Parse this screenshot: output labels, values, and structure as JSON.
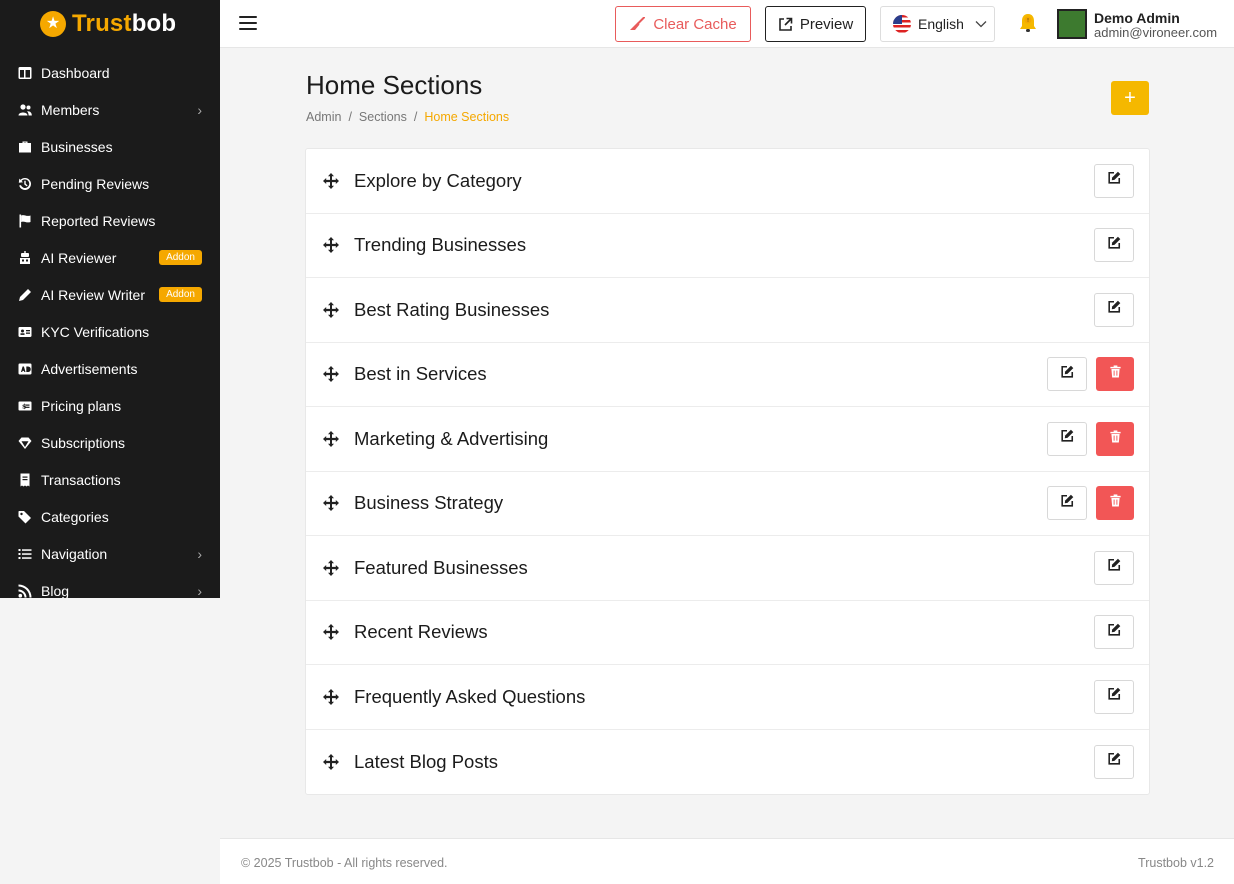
{
  "brand": {
    "name_part1": "Trust",
    "name_part2": "bob",
    "accent": "#f5a800"
  },
  "sidebar": {
    "items": [
      {
        "label": "Dashboard",
        "icon": "dashboard-icon",
        "chevron": false,
        "badge": ""
      },
      {
        "label": "Members",
        "icon": "users-icon",
        "chevron": true,
        "badge": ""
      },
      {
        "label": "Businesses",
        "icon": "briefcase-icon",
        "chevron": false,
        "badge": ""
      },
      {
        "label": "Pending Reviews",
        "icon": "history-icon",
        "chevron": false,
        "badge": ""
      },
      {
        "label": "Reported Reviews",
        "icon": "flag-icon",
        "chevron": false,
        "badge": ""
      },
      {
        "label": "AI Reviewer",
        "icon": "robot-icon",
        "chevron": false,
        "badge": "Addon"
      },
      {
        "label": "AI Review Writer",
        "icon": "pen-icon",
        "chevron": false,
        "badge": "Addon"
      },
      {
        "label": "KYC Verifications",
        "icon": "id-card-icon",
        "chevron": false,
        "badge": ""
      },
      {
        "label": "Advertisements",
        "icon": "ad-icon",
        "chevron": false,
        "badge": ""
      },
      {
        "label": "Pricing plans",
        "icon": "money-icon",
        "chevron": false,
        "badge": ""
      },
      {
        "label": "Subscriptions",
        "icon": "gem-icon",
        "chevron": false,
        "badge": ""
      },
      {
        "label": "Transactions",
        "icon": "receipt-icon",
        "chevron": false,
        "badge": ""
      },
      {
        "label": "Categories",
        "icon": "tags-icon",
        "chevron": false,
        "badge": ""
      },
      {
        "label": "Navigation",
        "icon": "list-icon",
        "chevron": true,
        "badge": ""
      },
      {
        "label": "Blog",
        "icon": "rss-icon",
        "chevron": true,
        "badge": ""
      }
    ]
  },
  "topbar": {
    "clear_cache_label": "Clear Cache",
    "preview_label": "Preview",
    "language": "English",
    "user_name": "Demo Admin",
    "user_email": "admin@vironeer.com"
  },
  "page": {
    "title": "Home Sections",
    "breadcrumb": [
      "Admin",
      "Sections",
      "Home Sections"
    ],
    "add_label": "+"
  },
  "sections": [
    {
      "title": "Explore by Category",
      "deletable": false
    },
    {
      "title": "Trending Businesses",
      "deletable": false
    },
    {
      "title": "Best Rating Businesses",
      "deletable": false
    },
    {
      "title": "Best in Services",
      "deletable": true
    },
    {
      "title": "Marketing & Advertising",
      "deletable": true
    },
    {
      "title": "Business Strategy",
      "deletable": true
    },
    {
      "title": "Featured Businesses",
      "deletable": false
    },
    {
      "title": "Recent Reviews",
      "deletable": false
    },
    {
      "title": "Frequently Asked Questions",
      "deletable": false
    },
    {
      "title": "Latest Blog Posts",
      "deletable": false
    }
  ],
  "footer": {
    "copyright": "© 2025 Trustbob - All rights reserved.",
    "version": "Trustbob v1.2"
  },
  "colors": {
    "danger": "#f25656",
    "accent": "#f5b800"
  }
}
